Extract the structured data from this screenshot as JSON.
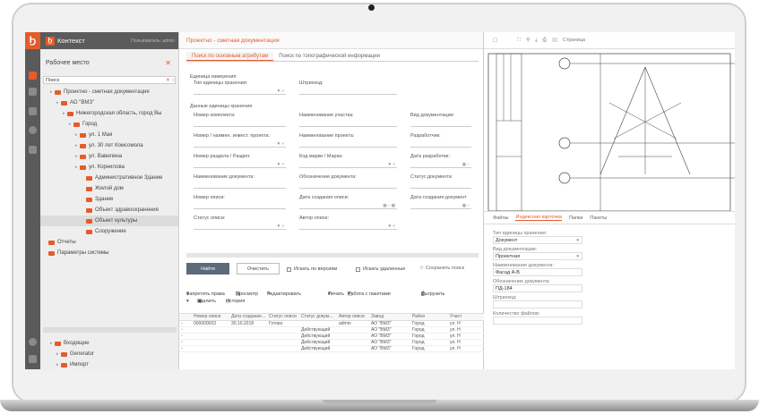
{
  "app": {
    "brand": "Контекст",
    "user": "Пользователь: admin"
  },
  "sidebar": {
    "workspace": "Рабочее место",
    "search_value": "Поиск",
    "tree": [
      {
        "label": "Проектно - сметная документация",
        "level": 1
      },
      {
        "label": "АО \"ВМЗ\"",
        "level": 2
      },
      {
        "label": "Нижегородская область, город Вы",
        "level": 3
      },
      {
        "label": "Город",
        "level": 4
      },
      {
        "label": "ул. 1 Мая",
        "level": 5
      },
      {
        "label": "ул. 30 лет Комсомола",
        "level": 5
      },
      {
        "label": "ул. Вавилина",
        "level": 5
      },
      {
        "label": "ул. Корнилова",
        "level": 5
      },
      {
        "label": "Административное Здание",
        "level": 6
      },
      {
        "label": "Жилой дом",
        "level": 6
      },
      {
        "label": "Здание",
        "level": 6
      },
      {
        "label": "Объект здравоохранения",
        "level": 6
      },
      {
        "label": "Объект культуры",
        "level": 6,
        "selected": true
      },
      {
        "label": "Сооружение",
        "level": 6
      },
      {
        "label": "Отчеты",
        "level": 0
      },
      {
        "label": "Параметры системы",
        "level": 0
      }
    ],
    "bottom": [
      {
        "label": "Входящие",
        "level": 1
      },
      {
        "label": "Generator",
        "level": 2
      },
      {
        "label": "Импорт",
        "level": 2
      }
    ]
  },
  "main": {
    "title": "Проектно - сметная документация",
    "tabs": [
      "Поиск по основным атрибутам",
      "Поиск по топографической информации"
    ],
    "form": {
      "unit_section": "Единица измерения",
      "storage_type": "Тип единицы хранения:",
      "barcode": "Штрихкод:",
      "data_section": "Данные единицы хранения",
      "complex_number": "Номер комплекта:",
      "site_name": "Наименование участка:",
      "doc_type": "Вид документации:",
      "investment_project": "Номер / наимен. инвест. проекта:",
      "project_name": "Наименование проекта:",
      "developer": "Разработчик:",
      "section_number": "Номер раздела / Раздел:",
      "brand_code": "Код марки / Марка:",
      "dev_date": "Дата разработки:",
      "doc_name": "Наименование документа:",
      "doc_designation": "Обозначение документа:",
      "doc_status": "Статус документа:",
      "inventory_number": "Номер описи:",
      "inventory_date": "Дата создания описи:",
      "doc_create_date": "Дата создания документ",
      "inventory_status": "Статус описи:",
      "inventory_author": "Автор описи:"
    },
    "buttons": {
      "find": "Найти",
      "clear": "Очистить",
      "by_versions": "Искать по версиям",
      "deleted": "Искать удаленные",
      "save_search": "Сохранить поиск"
    },
    "toolbar": {
      "forbid": "Запретить права",
      "view": "Просмотр",
      "edit": "Редактировать",
      "print": "Печать",
      "packages": "Работа с пакетами",
      "export": "Выгрузить",
      "delete": "Удалить",
      "history": "История"
    },
    "grid": {
      "columns": [
        "Номер описи",
        "Дата создание...",
        "Статус описи",
        "Статус докум...",
        "Автор описи",
        "Завод",
        "Район",
        "Участ"
      ],
      "rows": [
        [
          "000000003",
          "30.10.2018",
          "Готово",
          "",
          "admin",
          "АО \"ВМЗ\"",
          "Город",
          "ул. Н"
        ],
        [
          "",
          "",
          "",
          "Действующий",
          "",
          "АО \"ВМЗ\"",
          "Город",
          "ул. Н"
        ],
        [
          "",
          "",
          "",
          "Действующий",
          "",
          "АО \"ВМЗ\"",
          "Город",
          "ул. Н"
        ],
        [
          "",
          "",
          "",
          "Действующий",
          "",
          "АО \"ВМЗ\"",
          "Город",
          "ул. Н"
        ],
        [
          "",
          "",
          "",
          "Действующий",
          "",
          "АО \"ВМЗ\"",
          "Город",
          "ул. Н"
        ]
      ]
    }
  },
  "viewer": {
    "page_label": "Страница"
  },
  "card": {
    "tabs": [
      "Файлы",
      "Индексная карточка",
      "Папки",
      "Пакеты"
    ],
    "fields": [
      {
        "label": "Тип единицы хранения:",
        "value": "Документ",
        "dropdown": true
      },
      {
        "label": "Вид документации:",
        "value": "Проектная",
        "dropdown": true
      },
      {
        "label": "Наименование документа:",
        "value": "Фасад А-В"
      },
      {
        "label": "Обозначение документа:",
        "value": "ПД-184"
      },
      {
        "label": "Штрихкод:",
        "value": ""
      },
      {
        "label": "Количество файлов:",
        "value": ""
      }
    ]
  }
}
